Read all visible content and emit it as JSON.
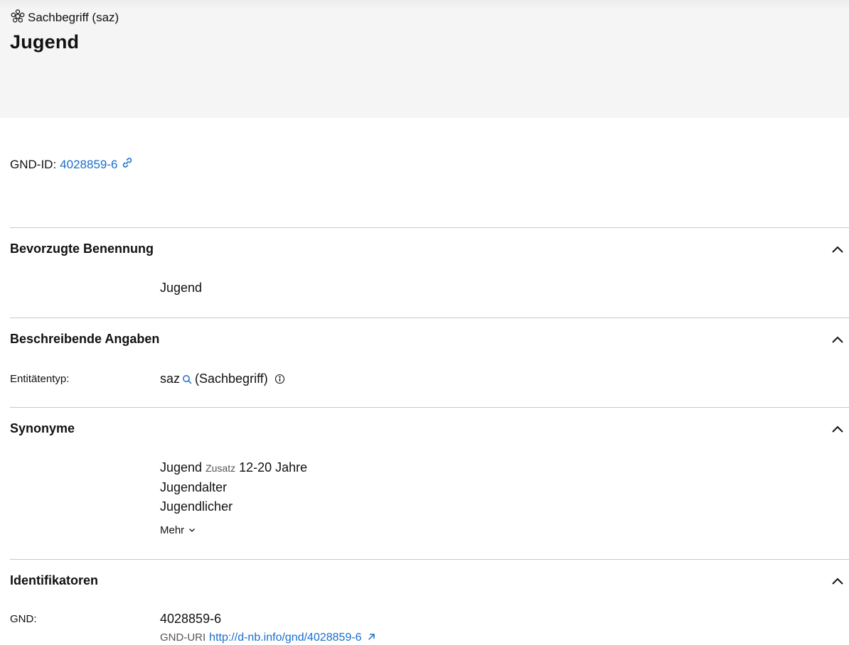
{
  "header": {
    "entity_type_label": "Sachbegriff (saz)",
    "title": "Jugend",
    "background": "#f5f5f5"
  },
  "gnd_id": {
    "label": "GND-ID:",
    "value": "4028859-6",
    "link_color": "#1a6dcc",
    "icon": "link-icon"
  },
  "sections": {
    "bevorzugte": {
      "title": "Bevorzugte Benennung",
      "value": "Jugend"
    },
    "beschreibende": {
      "title": "Beschreibende Angaben",
      "entitaetentyp_label": "Entitätentyp:",
      "entitaetentyp_code": "saz",
      "entitaetentyp_name": "(Sachbegriff)"
    },
    "synonyme": {
      "title": "Synonyme",
      "items": [
        {
          "name": "Jugend",
          "zusatz_label": "Zusatz",
          "zusatz_value": "12-20 Jahre"
        },
        {
          "name": "Jugendalter"
        },
        {
          "name": "Jugendlicher"
        }
      ],
      "more_label": "Mehr"
    },
    "identifikatoren": {
      "title": "Identifikatoren",
      "gnd_label": "GND:",
      "gnd_value": "4028859-6",
      "uri_label": "GND-URI",
      "uri_value": "http://d-nb.info/gnd/4028859-6"
    }
  }
}
